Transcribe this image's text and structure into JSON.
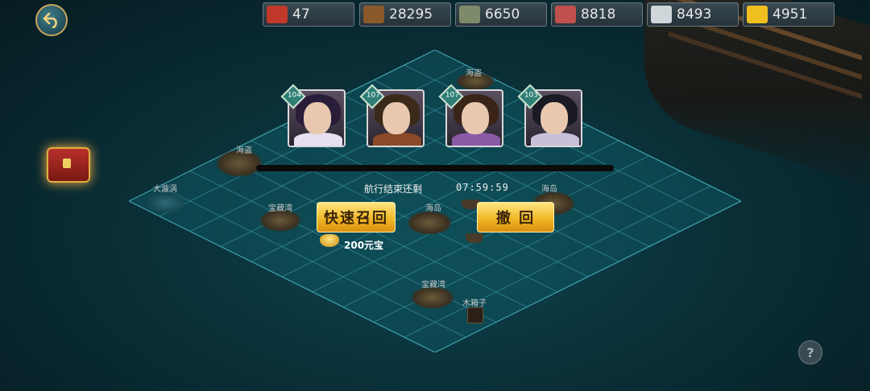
{
  "resources": [
    {
      "name": "rank-icon",
      "value": "47",
      "color": "#c0392b"
    },
    {
      "name": "wood-icon",
      "value": "28295",
      "color": "#8a5a2b"
    },
    {
      "name": "stone-icon",
      "value": "6650",
      "color": "#7d8b6a"
    },
    {
      "name": "meat-icon",
      "value": "8818",
      "color": "#c0504d"
    },
    {
      "name": "silver-icon",
      "value": "8493",
      "color": "#cfd6da"
    },
    {
      "name": "gold-ingot-icon",
      "value": "4951",
      "color": "#f0c020"
    }
  ],
  "heroes": [
    {
      "level": "104",
      "name": "hero-portrait-1",
      "hair": "#2a1d3a",
      "outfit": "#e8e0f0"
    },
    {
      "level": "107",
      "name": "hero-portrait-2",
      "hair": "#3b2a1a",
      "outfit": "#8a4a2a"
    },
    {
      "level": "107",
      "name": "hero-portrait-3",
      "hair": "#3a2418",
      "outfit": "#8b5aa6"
    },
    {
      "level": "103",
      "name": "hero-portrait-4",
      "hair": "#1a1a24",
      "outfit": "#c8c0d8"
    }
  ],
  "voyage": {
    "remaining_label": "航行结束还剩",
    "timer": "07:59:59",
    "quick_recall_label": "快速召回",
    "withdraw_label": "撤 回",
    "cost": "200元宝"
  },
  "map_labels": {
    "top": "海盗",
    "left_island": "海盗",
    "whirlpool": "大漩涡",
    "treasure_left": "宝藏湾",
    "center_island": "海岛",
    "right_island": "海岛",
    "treasure_bottom": "宝藏湾",
    "chest_bottom": "木箱子"
  },
  "help_label": "?"
}
